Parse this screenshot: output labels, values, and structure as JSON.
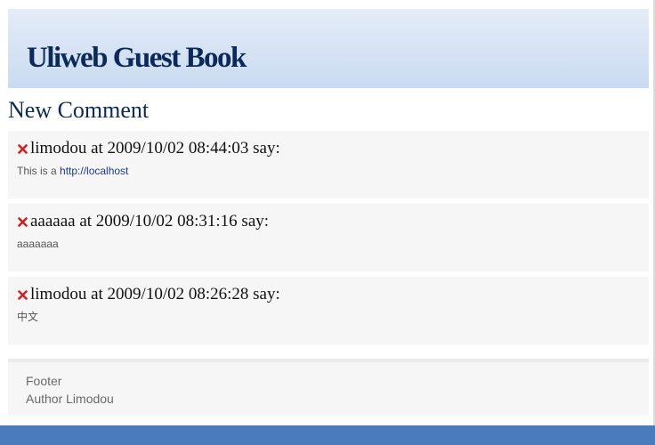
{
  "header": {
    "title": "Uliweb Guest Book"
  },
  "section_title": "New Comment",
  "comments": [
    {
      "author": "limodou",
      "title": "limodou at 2009/10/02 08:44:03 say:",
      "body_prefix": "This is a ",
      "body_link": "http://localhost"
    },
    {
      "author": "aaaaaa",
      "title": "aaaaaa at 2009/10/02 08:31:16 say:",
      "body": "aaaaaaa"
    },
    {
      "author": "limodou",
      "title": "limodou at 2009/10/02 08:26:28 say:",
      "body": "中文"
    }
  ],
  "footer": {
    "line1": "Footer",
    "line2": "Author Limodou"
  },
  "icons": {
    "delete": "delete-x-icon"
  },
  "colors": {
    "title": "#0b2a5a",
    "header_gradient_top": "#e4ecf7",
    "header_gradient_bottom": "#c9dbf1",
    "delete_icon": "#cc2222",
    "bottom_bar": "#4a7bbd",
    "link": "#1a3a8a"
  }
}
